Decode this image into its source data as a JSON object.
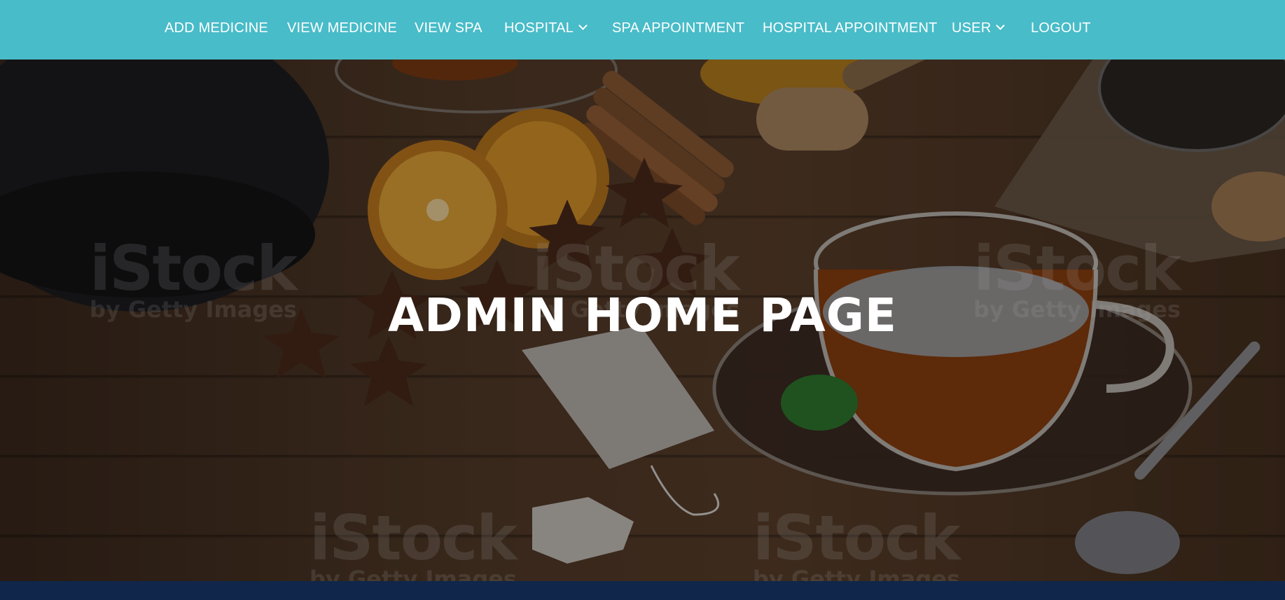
{
  "nav": {
    "items": [
      {
        "label": "ADD MEDICINE",
        "dropdown": false
      },
      {
        "label": "VIEW MEDICINE",
        "dropdown": false
      },
      {
        "label": "VIEW SPA",
        "dropdown": false
      },
      {
        "label": "HOSPITAL",
        "dropdown": true
      },
      {
        "label": "SPA APPOINTMENT",
        "dropdown": false
      },
      {
        "label": "HOSPITAL APPOINTMENT",
        "dropdown": false
      },
      {
        "label": "USER",
        "dropdown": true
      },
      {
        "label": "LOGOUT",
        "dropdown": false
      }
    ]
  },
  "hero": {
    "title": "ADMIN HOME PAGE",
    "watermark": {
      "brand": "iStock",
      "tagline": "by Getty Images"
    }
  },
  "colors": {
    "navbar_bg": "#48bcc8",
    "nav_text": "#ffffff",
    "footer_bg": "#10264a"
  },
  "icons": {
    "dropdown": "chevron-down-icon"
  }
}
